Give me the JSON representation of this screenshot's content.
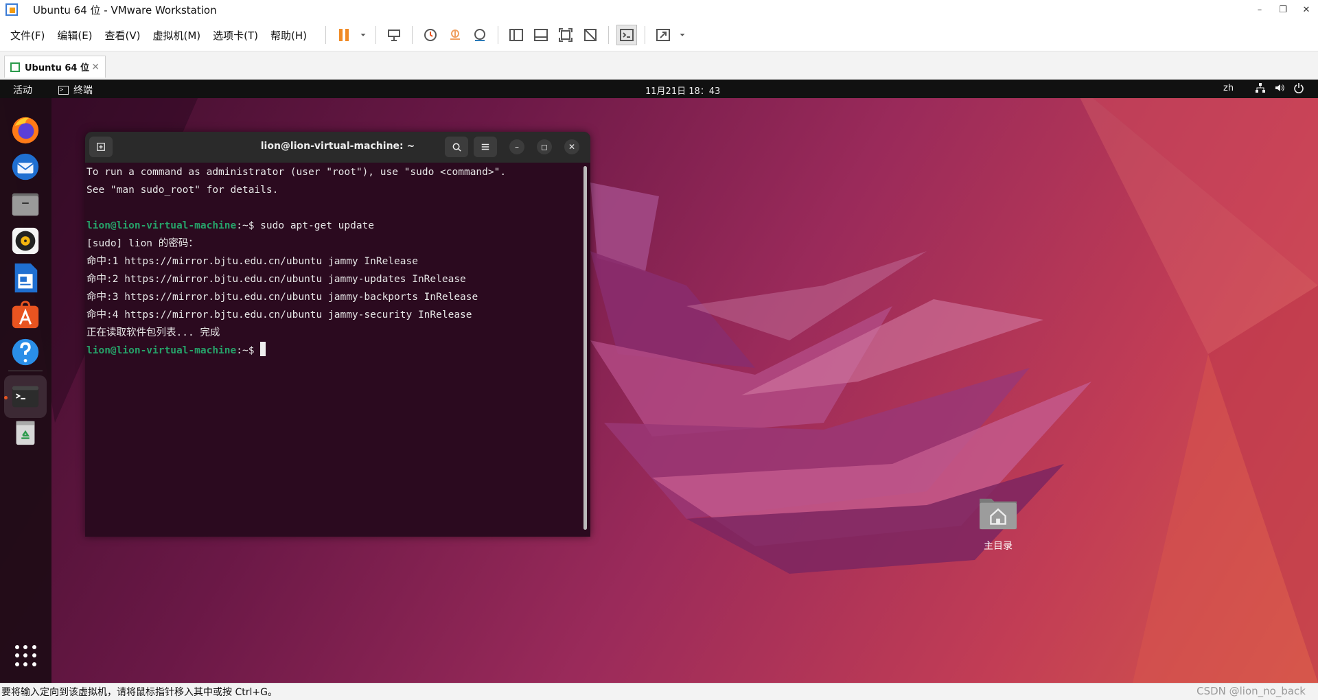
{
  "window": {
    "title": "Ubuntu 64 位 - VMware Workstation",
    "controls": [
      "–",
      "❐",
      "✕"
    ]
  },
  "menu": [
    "文件(F)",
    "编辑(E)",
    "查看(V)",
    "虚拟机(M)",
    "选项卡(T)",
    "帮助(H)"
  ],
  "tab": {
    "label": "Ubuntu 64 位",
    "close": "✕"
  },
  "topbar": {
    "activities": "活动",
    "app": "终端",
    "clock": "11月21日 18：43",
    "lang": "zh"
  },
  "terminal": {
    "title": "lion@lion-virtual-machine: ~",
    "lines": [
      "To run a command as administrator (user \"root\"), use \"sudo <command>\".",
      "See \"man sudo_root\" for details.",
      "",
      "",
      "[sudo] lion 的密码：",
      "命中:1 https://mirror.bjtu.edu.cn/ubuntu jammy InRelease",
      "命中:2 https://mirror.bjtu.edu.cn/ubuntu jammy-updates InRelease",
      "命中:3 https://mirror.bjtu.edu.cn/ubuntu jammy-backports InRelease",
      "命中:4 https://mirror.bjtu.edu.cn/ubuntu jammy-security InRelease",
      "正在读取软件包列表... 完成"
    ],
    "prompt_user": "lion@lion-virtual-machine",
    "prompt_suffix": ":~$ ",
    "command": "sudo apt-get update"
  },
  "desktop": {
    "home_label": "主目录"
  },
  "status": {
    "message": "要将输入定向到该虚拟机，请将鼠标指针移入其中或按 Ctrl+G。",
    "watermark": "CSDN @lion_no_back"
  },
  "colors": {
    "accent": "#e95420",
    "prompt": "#26a269",
    "terminal_bg": "#2b0a1f"
  }
}
